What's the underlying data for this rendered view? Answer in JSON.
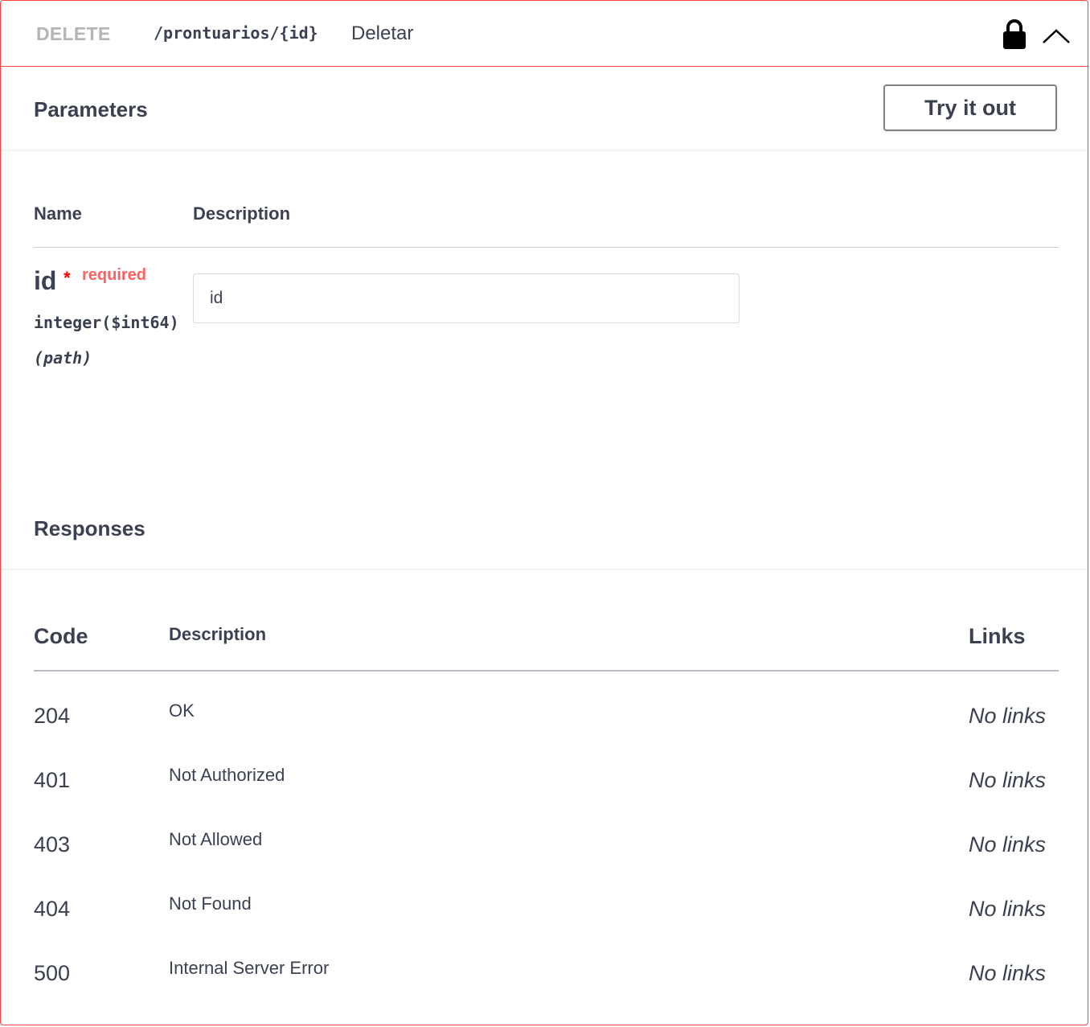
{
  "operation": {
    "method": "DELETE",
    "path": "/prontuarios/{id}",
    "summary": "Deletar",
    "lock_icon": "lock-icon",
    "collapse_icon": "chevron-up-icon",
    "border_color": "#f93e3e"
  },
  "parameters": {
    "title": "Parameters",
    "try_label": "Try it out",
    "col_name": "Name",
    "col_description": "Description",
    "items": [
      {
        "name": "id",
        "star": "*",
        "required_label": "required",
        "type": "integer($int64)",
        "in": "(path)",
        "placeholder": "id",
        "value": ""
      }
    ]
  },
  "responses": {
    "title": "Responses",
    "col_code": "Code",
    "col_description": "Description",
    "col_links": "Links",
    "rows": [
      {
        "code": "204",
        "description": "OK",
        "links": "No links"
      },
      {
        "code": "401",
        "description": "Not Authorized",
        "links": "No links"
      },
      {
        "code": "403",
        "description": "Not Allowed",
        "links": "No links"
      },
      {
        "code": "404",
        "description": "Not Found",
        "links": "No links"
      },
      {
        "code": "500",
        "description": "Internal Server Error",
        "links": "No links"
      }
    ]
  }
}
